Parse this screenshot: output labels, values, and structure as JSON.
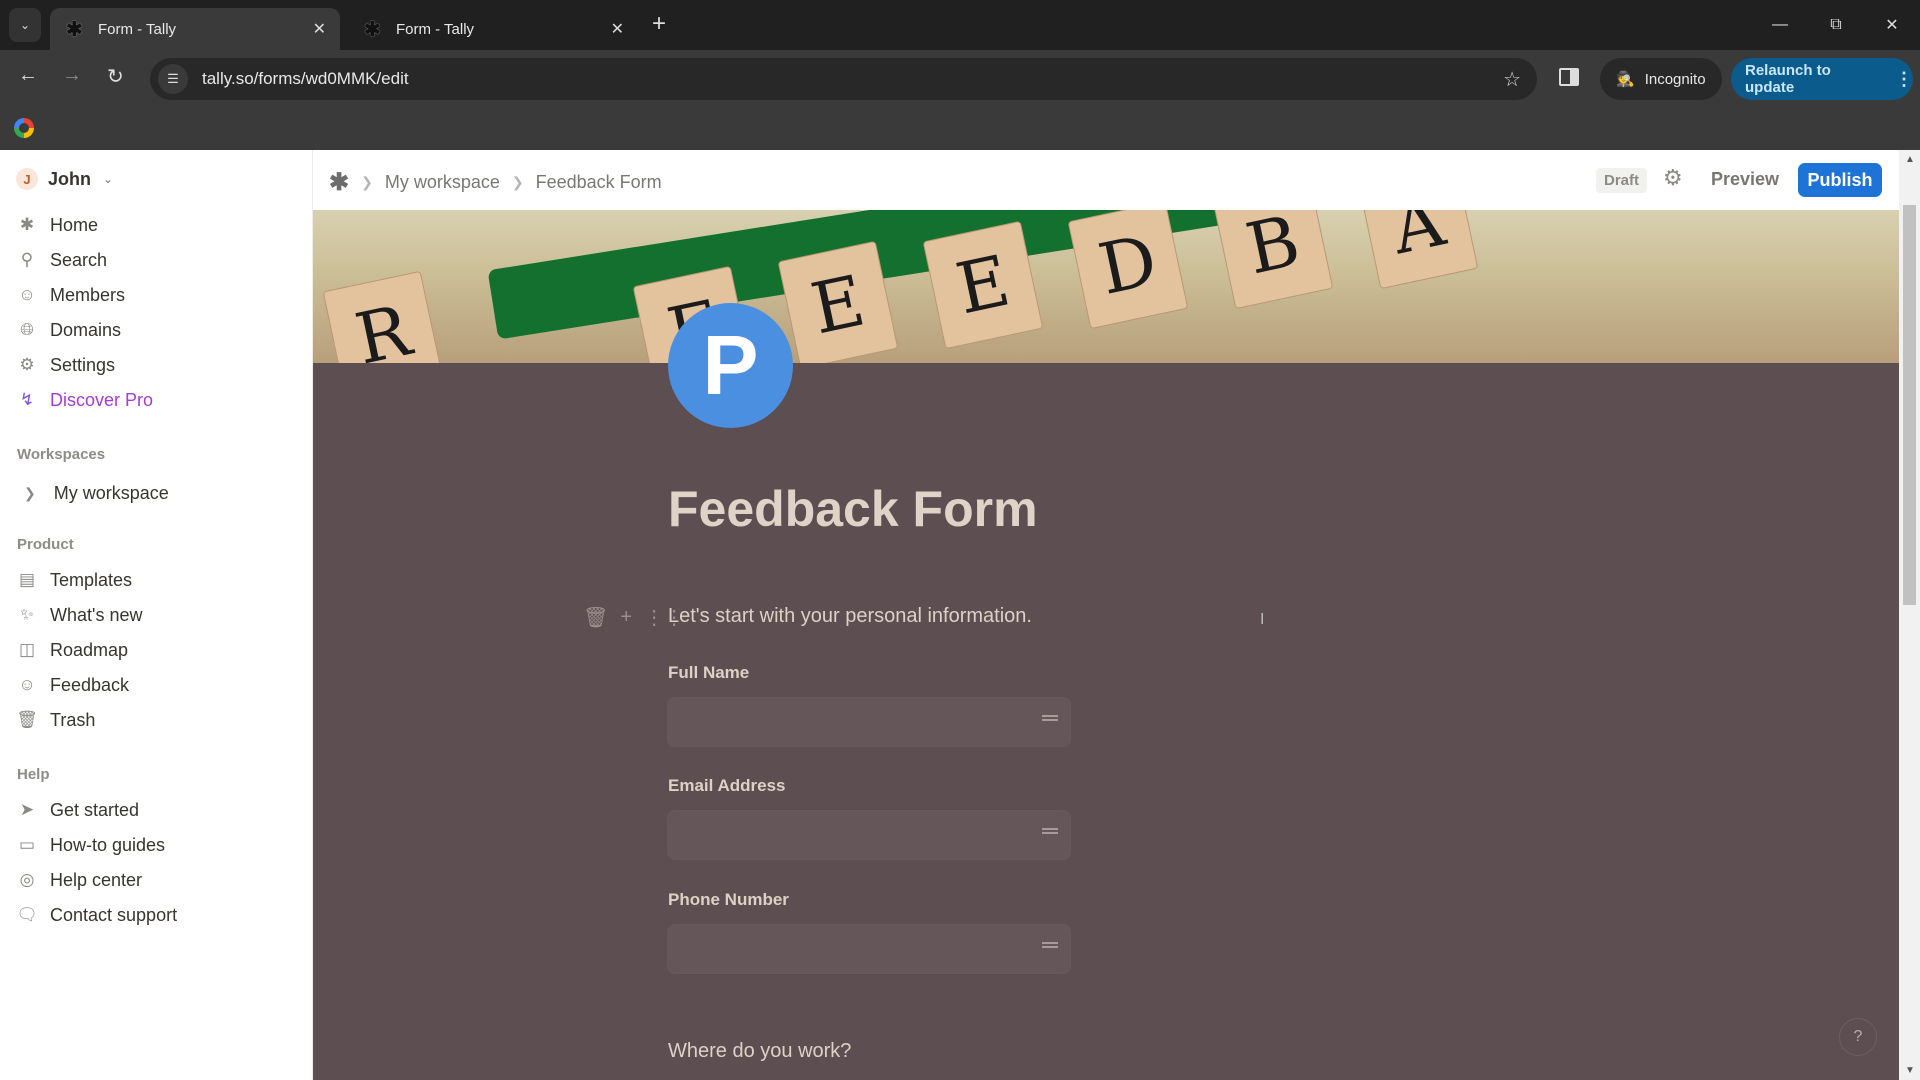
{
  "browser": {
    "tabs": [
      {
        "label": "Form - Tally",
        "active": true
      },
      {
        "label": "Form - Tally",
        "active": false
      }
    ],
    "new_tab_label": "+",
    "url": "tally.so/forms/wd0MMK/edit",
    "incognito_label": "Incognito",
    "relaunch_label": "Relaunch to update"
  },
  "sidebar": {
    "user": {
      "initial": "J",
      "name": "John"
    },
    "nav": [
      {
        "label": "Home",
        "icon": "tally-asterisk-icon"
      },
      {
        "label": "Search",
        "icon": "search-icon"
      },
      {
        "label": "Members",
        "icon": "members-icon"
      },
      {
        "label": "Domains",
        "icon": "globe-icon"
      },
      {
        "label": "Settings",
        "icon": "gear-icon"
      },
      {
        "label": "Discover Pro",
        "icon": "lightning-icon",
        "accent": "#a43bd6"
      }
    ],
    "workspaces_label": "Workspaces",
    "workspaces": [
      {
        "label": "My workspace"
      }
    ],
    "product_label": "Product",
    "product": [
      {
        "label": "Templates",
        "icon": "templates-icon"
      },
      {
        "label": "What's new",
        "icon": "sparkles-icon"
      },
      {
        "label": "Roadmap",
        "icon": "map-icon"
      },
      {
        "label": "Feedback",
        "icon": "smiley-icon"
      },
      {
        "label": "Trash",
        "icon": "trash-icon"
      }
    ],
    "help_label": "Help",
    "help": [
      {
        "label": "Get started",
        "icon": "send-icon"
      },
      {
        "label": "How-to guides",
        "icon": "book-icon"
      },
      {
        "label": "Help center",
        "icon": "lifebuoy-icon"
      },
      {
        "label": "Contact support",
        "icon": "chat-bubble-icon"
      }
    ]
  },
  "topbar": {
    "breadcrumb": [
      "My workspace",
      "Feedback Form"
    ],
    "status_badge": "Draft",
    "preview_label": "Preview",
    "publish_label": "Publish",
    "accent": "#1d74d6"
  },
  "form": {
    "cover_letters": [
      "R",
      "F",
      "E",
      "E",
      "D",
      "B",
      "A"
    ],
    "logo_letter": "P",
    "title": "Feedback Form",
    "intro": "Let's start with your personal information.",
    "fields": [
      {
        "label": "Full Name",
        "value": ""
      },
      {
        "label": "Email Address",
        "value": ""
      },
      {
        "label": "Phone Number",
        "value": ""
      }
    ],
    "next_question": "Where do you work?",
    "background": "#5d4e51",
    "help_label": "?"
  }
}
